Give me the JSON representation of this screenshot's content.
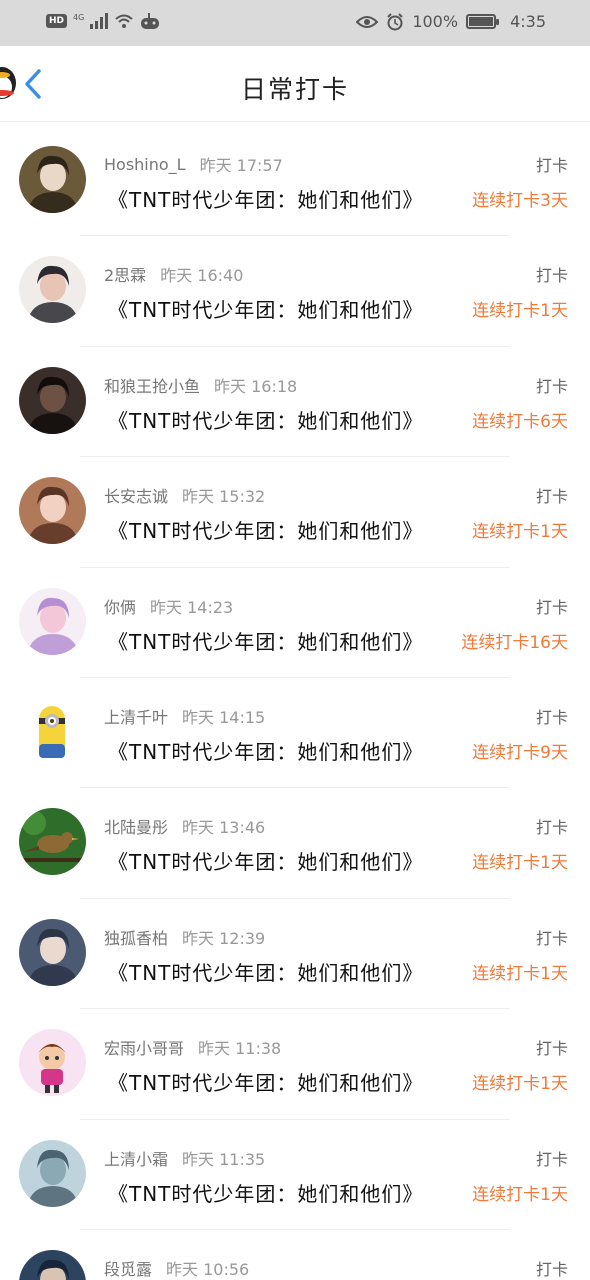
{
  "status_bar": {
    "hd": "HD",
    "network": "4G",
    "battery_percent": "100%",
    "battery_level": 1.0,
    "time": "4:35"
  },
  "header": {
    "title": "日常打卡"
  },
  "items": [
    {
      "name": "Hoshino_L",
      "time": "昨天 17:57",
      "tag": "打卡",
      "group": "《TNT时代少年团：她们和他们》",
      "streak": "连续打卡3天"
    },
    {
      "name": "2思霖",
      "time": "昨天 16:40",
      "tag": "打卡",
      "group": "《TNT时代少年团：她们和他们》",
      "streak": "连续打卡1天"
    },
    {
      "name": "和狼王抢小鱼",
      "time": "昨天 16:18",
      "tag": "打卡",
      "group": "《TNT时代少年团：她们和他们》",
      "streak": "连续打卡6天"
    },
    {
      "name": "长安志诚",
      "time": "昨天 15:32",
      "tag": "打卡",
      "group": "《TNT时代少年团：她们和他们》",
      "streak": "连续打卡1天"
    },
    {
      "name": "你俩",
      "time": "昨天 14:23",
      "tag": "打卡",
      "group": "《TNT时代少年团：她们和他们》",
      "streak": "连续打卡16天"
    },
    {
      "name": "上清千叶",
      "time": "昨天 14:15",
      "tag": "打卡",
      "group": "《TNT时代少年团：她们和他们》",
      "streak": "连续打卡9天"
    },
    {
      "name": "北陆曼彤",
      "time": "昨天 13:46",
      "tag": "打卡",
      "group": "《TNT时代少年团：她们和他们》",
      "streak": "连续打卡1天"
    },
    {
      "name": "独孤香柏",
      "time": "昨天 12:39",
      "tag": "打卡",
      "group": "《TNT时代少年团：她们和他们》",
      "streak": "连续打卡1天"
    },
    {
      "name": "宏雨小哥哥",
      "time": "昨天 11:38",
      "tag": "打卡",
      "group": "《TNT时代少年团：她们和他们》",
      "streak": "连续打卡1天"
    },
    {
      "name": "上清小霜",
      "time": "昨天 11:35",
      "tag": "打卡",
      "group": "《TNT时代少年团：她们和他们》",
      "streak": "连续打卡1天"
    },
    {
      "name": "段觅露",
      "time": "昨天 10:56",
      "tag": "打卡",
      "group": "",
      "streak": ""
    }
  ],
  "avatars": [
    {
      "bg": "#6b5a3a",
      "fg": "#e9d8c6",
      "accent": "#2d2419",
      "icon": "avatar-photo-icon"
    },
    {
      "bg": "#f0ece9",
      "fg": "#e8c4b4",
      "accent": "#2a2a30",
      "icon": "avatar-photo-icon"
    },
    {
      "bg": "#3a2e2a",
      "fg": "#6d5144",
      "accent": "#120d0b",
      "icon": "avatar-photo-icon"
    },
    {
      "bg": "#b07a5a",
      "fg": "#f1d1c2",
      "accent": "#5a3424",
      "icon": "avatar-photo-icon"
    },
    {
      "bg": "#f5eef5",
      "fg": "#f4c7d8",
      "accent": "#b68fd2",
      "icon": "avatar-photo-icon"
    },
    {
      "bg": "#ffffff",
      "fg": "#f5d33b",
      "accent": "#3b6bb4",
      "icon": "minion-icon"
    },
    {
      "bg": "#2f6d2a",
      "fg": "#8d6a35",
      "accent": "#4f9a3f",
      "icon": "bird-icon"
    },
    {
      "bg": "#4b5a72",
      "fg": "#e9d9cf",
      "accent": "#2c3447",
      "icon": "avatar-photo-icon"
    },
    {
      "bg": "#f8e3f2",
      "fg": "#f3c9a8",
      "accent": "#d4378a",
      "icon": "cartoon-boy-icon"
    },
    {
      "bg": "#bfd3dc",
      "fg": "#8aa9b5",
      "accent": "#4c6471",
      "icon": "avatar-photo-icon"
    },
    {
      "bg": "#2d4460",
      "fg": "#d9c3b2",
      "accent": "#17253a",
      "icon": "avatar-photo-icon"
    }
  ],
  "colors": {
    "streak": "#f07a39",
    "status_bar_bg": "#dadada",
    "back_chevron": "#3a8ee6"
  }
}
